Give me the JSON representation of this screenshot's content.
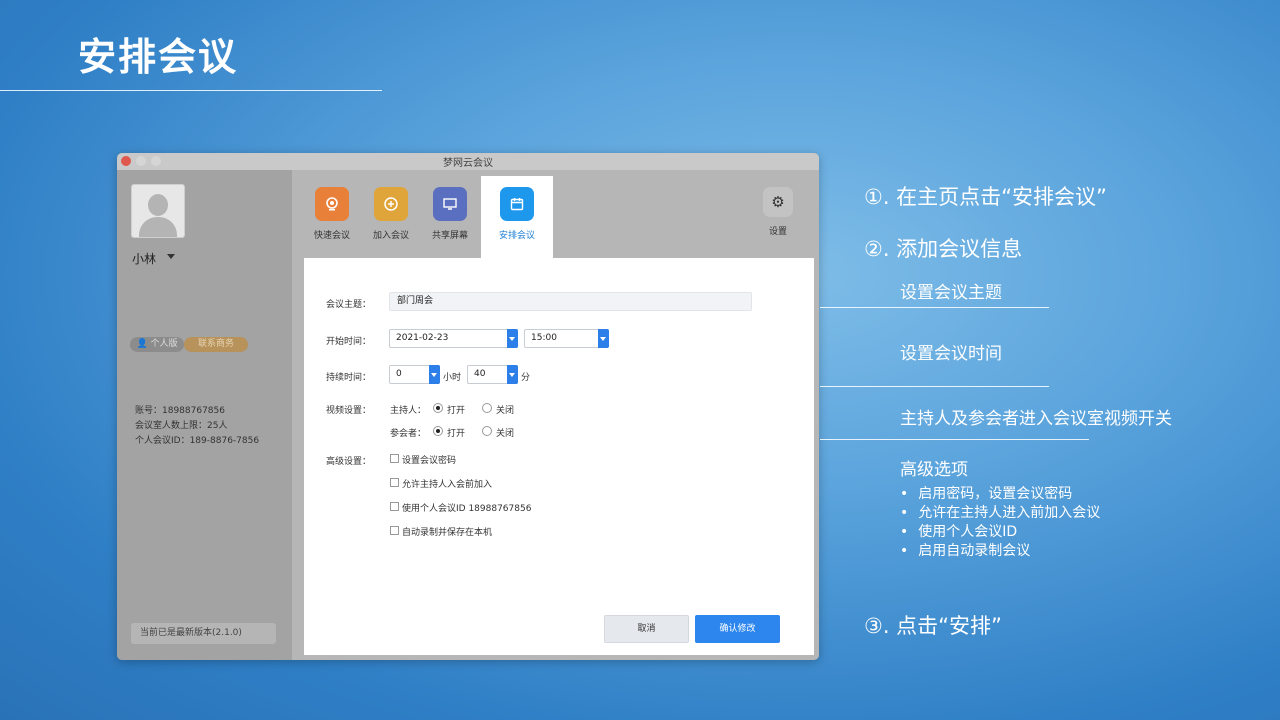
{
  "slide": {
    "title": "安排会议"
  },
  "window": {
    "title": "梦网云会议"
  },
  "sidebar": {
    "user_name": "小林",
    "badge_personal": "个人版",
    "badge_contact": "联系商务",
    "account_lines": [
      "账号：18988767856",
      "会议室人数上限：25人",
      "个人会议ID：189-8876-7856"
    ],
    "version": "当前已是最新版本(2.1.0)"
  },
  "toolbar": {
    "items": [
      {
        "label": "快速会议",
        "icon": "video-icon",
        "color": "#e8803a"
      },
      {
        "label": "加入会议",
        "icon": "plus-icon",
        "color": "#e0a53a"
      },
      {
        "label": "共享屏幕",
        "icon": "screen-icon",
        "color": "#5a6fbf"
      },
      {
        "label": "安排会议",
        "icon": "calendar-icon",
        "color": "#1e98ec"
      }
    ],
    "settings_label": "设置"
  },
  "form": {
    "topic_label": "会议主题：",
    "topic_value": "部门周会",
    "start_label": "开始时间：",
    "start_date": "2021-02-23",
    "start_time": "15:00",
    "duration_label": "持续时间：",
    "duration_hours": "0",
    "hours_unit": "小时",
    "duration_minutes": "40",
    "minutes_unit": "分",
    "video_label": "视频设置：",
    "host_label": "主持人：",
    "participant_label": "参会者：",
    "on_label": "打开",
    "off_label": "关闭",
    "host_video": "on",
    "participant_video": "on",
    "advanced_label": "高级设置：",
    "advanced_options": [
      "设置会议密码",
      "允许主持人入会前加入",
      "使用个人会议ID  18988767856",
      "自动录制并保存在本机"
    ],
    "cancel_label": "取消",
    "confirm_label": "确认修改"
  },
  "annotations": {
    "step1": "①. 在主页点击“安排会议”",
    "step2": "②. 添加会议信息",
    "topic": "设置会议主题",
    "time": "设置会议时间",
    "video": "主持人及参会者进入会议室视频开关",
    "advanced": "高级选项",
    "advanced_bullets": [
      "启用密码，设置会议密码",
      "允许在主持人进入前加入会议",
      "使用个人会议ID",
      "启用自动录制会议"
    ],
    "step3": "③. 点击“安排”"
  }
}
